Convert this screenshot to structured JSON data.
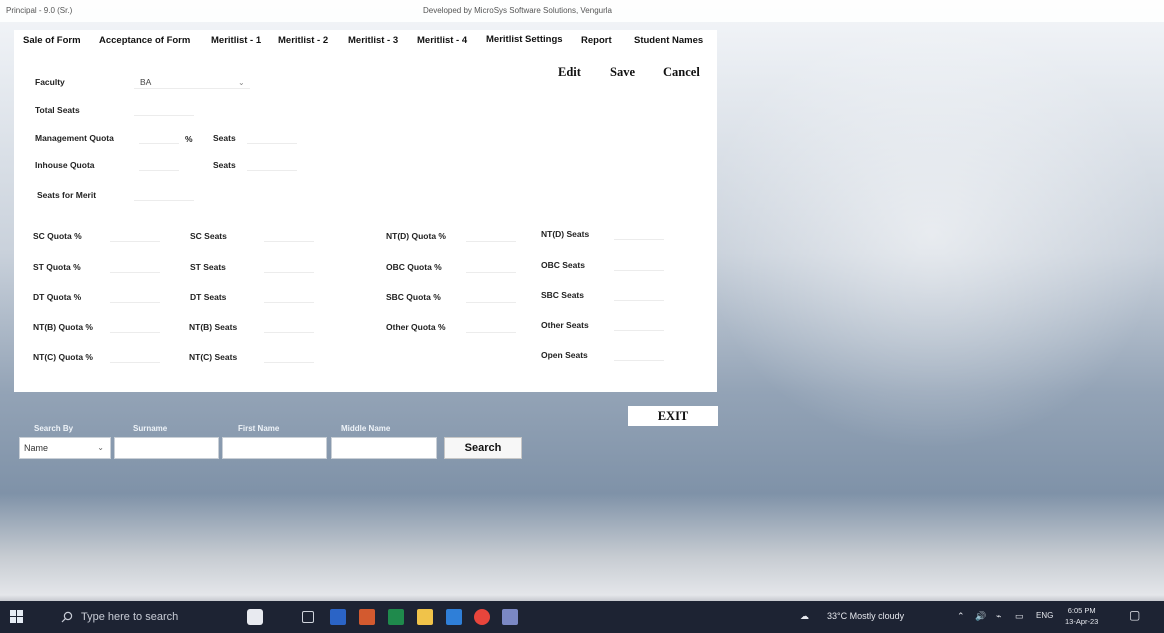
{
  "window": {
    "title_left": "Principal - 9.0 (Sr.)",
    "title_center": "Developed by MicroSys Software Solutions, Vengurla"
  },
  "tabs": [
    "Sale of Form",
    "Acceptance of Form",
    "Meritlist - 1",
    "Meritlist - 2",
    "Meritlist - 3",
    "Meritlist - 4",
    "Meritlist Settings",
    "Report",
    "Student Names"
  ],
  "commands": {
    "edit": "Edit",
    "save": "Save",
    "cancel": "Cancel"
  },
  "form": {
    "faculty_label": "Faculty",
    "faculty_value": "BA",
    "total_seats_label": "Total Seats",
    "management_quota_label": "Management Quota",
    "percent_sign": "%",
    "seats_label": "Seats",
    "inhouse_quota_label": "Inhouse Quota",
    "seats_for_merit_label": "Seats for Merit"
  },
  "quota": {
    "col1": [
      "SC Quota %",
      "ST Quota %",
      "DT Quota %",
      "NT(B) Quota %",
      "NT(C) Quota %"
    ],
    "col2": [
      "SC Seats",
      "ST Seats",
      "DT Seats",
      "NT(B) Seats",
      "NT(C) Seats"
    ],
    "col3": [
      "NT(D) Quota %",
      "OBC Quota %",
      "SBC Quota %",
      "Other Quota %"
    ],
    "col4": [
      "NT(D) Seats",
      "OBC Seats",
      "SBC Seats",
      "Other Seats",
      "Open Seats"
    ]
  },
  "search": {
    "search_by_label": "Search By",
    "surname_label": "Surname",
    "first_name_label": "First Name",
    "middle_name_label": "Middle Name",
    "search_by_value": "Name",
    "search_button": "Search"
  },
  "exit_button": "EXIT",
  "taskbar": {
    "search_placeholder": "Type here to search",
    "weather": "33°C  Mostly cloudy",
    "lang": "ENG",
    "time": "6:05 PM",
    "date": "13-Apr-23"
  }
}
